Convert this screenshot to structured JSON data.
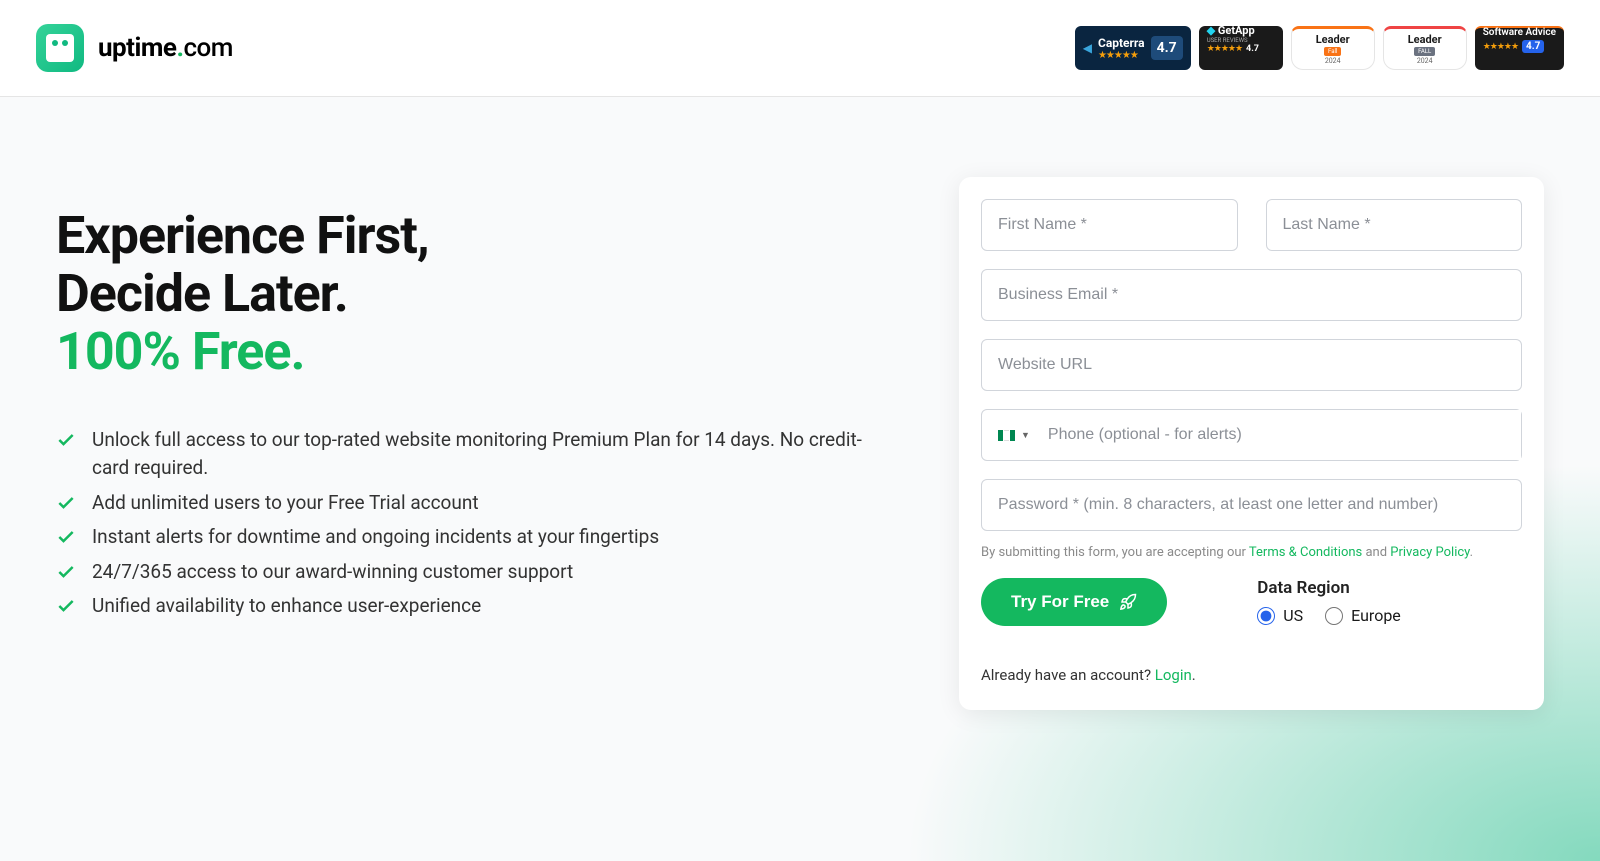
{
  "header": {
    "logo_text_main": "uptime",
    "logo_text_dot": ".",
    "logo_text_suffix": "com",
    "badges": {
      "capterra": {
        "name": "Capterra",
        "score": "4.7"
      },
      "getapp": {
        "name": "GetApp",
        "sub": "USER REVIEWS",
        "score": "4.7"
      },
      "leader1": {
        "title": "Leader",
        "bar": "Fall",
        "year": "2024"
      },
      "leader2": {
        "title": "Leader",
        "bar": "FALL",
        "year": "2024"
      },
      "software_advice": {
        "name": "Software Advice",
        "score": "4.7"
      }
    }
  },
  "hero": {
    "title_line1": "Experience First,",
    "title_line2": "Decide Later.",
    "title_accent": "100% Free.",
    "features": [
      "Unlock full access to our top-rated website monitoring Premium Plan for 14 days. No credit-card required.",
      "Add unlimited users to your Free Trial account",
      "Instant alerts for downtime and ongoing incidents at your fingertips",
      "24/7/365 access to our award-winning customer support",
      "Unified availability to enhance user-experience"
    ]
  },
  "form": {
    "first_name_ph": "First Name *",
    "last_name_ph": "Last Name *",
    "email_ph": "Business Email *",
    "website_ph": "Website URL",
    "phone_ph": "Phone (optional - for alerts)",
    "password_ph": "Password * (min. 8 characters, at least one letter and number)",
    "consent_prefix": "By submitting this form, you are accepting our ",
    "terms_label": "Terms & Conditions",
    "consent_and": " and ",
    "privacy_label": "Privacy Policy",
    "consent_suffix": ".",
    "submit_label": "Try For Free",
    "region_label": "Data Region",
    "region_us": "US",
    "region_eu": "Europe",
    "login_prefix": "Already have an account? ",
    "login_link": "Login",
    "login_suffix": "."
  }
}
